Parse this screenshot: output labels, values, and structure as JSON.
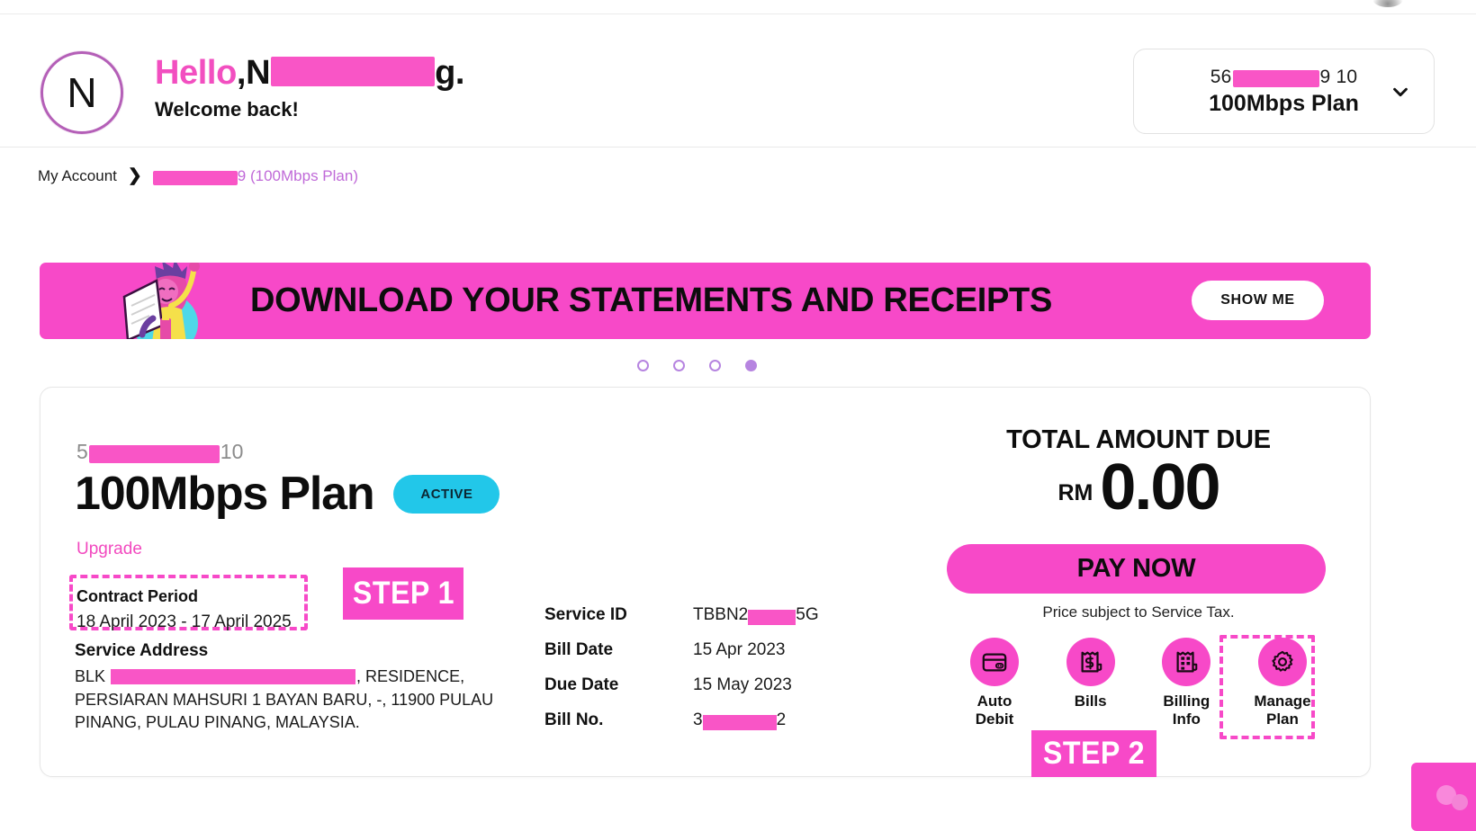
{
  "header": {
    "avatar_initial": "N",
    "greeting_hello": "Hello",
    "greeting_comma": ", ",
    "greeting_name_prefix": "N",
    "greeting_name_suffix": "g.",
    "welcome_text": "Welcome back!",
    "account_selector": {
      "number_prefix": "56",
      "number_suffix": "9 10",
      "plan": "100Mbps Plan",
      "chevron_icon": "chevron-down-icon"
    }
  },
  "breadcrumb": {
    "home": "My Account",
    "separator": "❯",
    "current_suffix": "9 (100Mbps Plan)"
  },
  "banner": {
    "title": "DOWNLOAD YOUR STATEMENTS AND RECEIPTS",
    "button_label": "SHOW ME",
    "background_color": "#f749c8",
    "illustration": "person-with-laptop-illustration"
  },
  "carousel": {
    "dot_count": 4,
    "active_index": 3,
    "dot_color": "#b684e0"
  },
  "plan_card": {
    "account_number_prefix": "5",
    "account_number_suffix": "10",
    "plan_name": "100Mbps Plan",
    "status_badge": "ACTIVE",
    "status_badge_color": "#22c7e9",
    "upgrade_link": "Upgrade",
    "contract_period_label": "Contract Period",
    "contract_period_value": "18 April 2023 - 17 April 2025",
    "service_address_label": "Service Address",
    "service_address_prefix": "BLK",
    "service_address_suffix": ", RESIDENCE,",
    "service_address_line2": "PERSIARAN MAHSURI 1 BAYAN BARU, -, 11900 PULAU",
    "service_address_line3": "PINANG, PULAU PINANG, MALAYSIA.",
    "info_rows": [
      {
        "key": "Service ID",
        "value_prefix": "TBBN2",
        "value_suffix": "5G",
        "redacted": true
      },
      {
        "key": "Bill Date",
        "value_prefix": "15 Apr 2023",
        "value_suffix": "",
        "redacted": false
      },
      {
        "key": "Due Date",
        "value_prefix": "15 May 2023",
        "value_suffix": "",
        "redacted": false
      },
      {
        "key": "Bill No.",
        "value_prefix": "3",
        "value_suffix": "2",
        "redacted": true
      }
    ]
  },
  "payment": {
    "total_label": "TOTAL AMOUNT DUE",
    "currency": "RM",
    "amount": "0.00",
    "pay_button": "PAY NOW",
    "tax_note": "Price subject to Service Tax.",
    "accent_color": "#f749c8"
  },
  "quick_actions": [
    {
      "icon": "credit-card-icon",
      "label_line1": "Auto",
      "label_line2": "Debit"
    },
    {
      "icon": "bill-dollar-icon",
      "label_line1": "Bills",
      "label_line2": ""
    },
    {
      "icon": "billing-info-icon",
      "label_line1": "Billing",
      "label_line2": "Info"
    },
    {
      "icon": "gear-icon",
      "label_line1": "Manage",
      "label_line2": "Plan"
    }
  ],
  "annotations": {
    "step1": "STEP 1",
    "step2": "STEP 2",
    "highlight_color": "#f749c8"
  },
  "chat_widget": {
    "icon": "chat-bubbles-icon",
    "color": "#f749c8"
  }
}
